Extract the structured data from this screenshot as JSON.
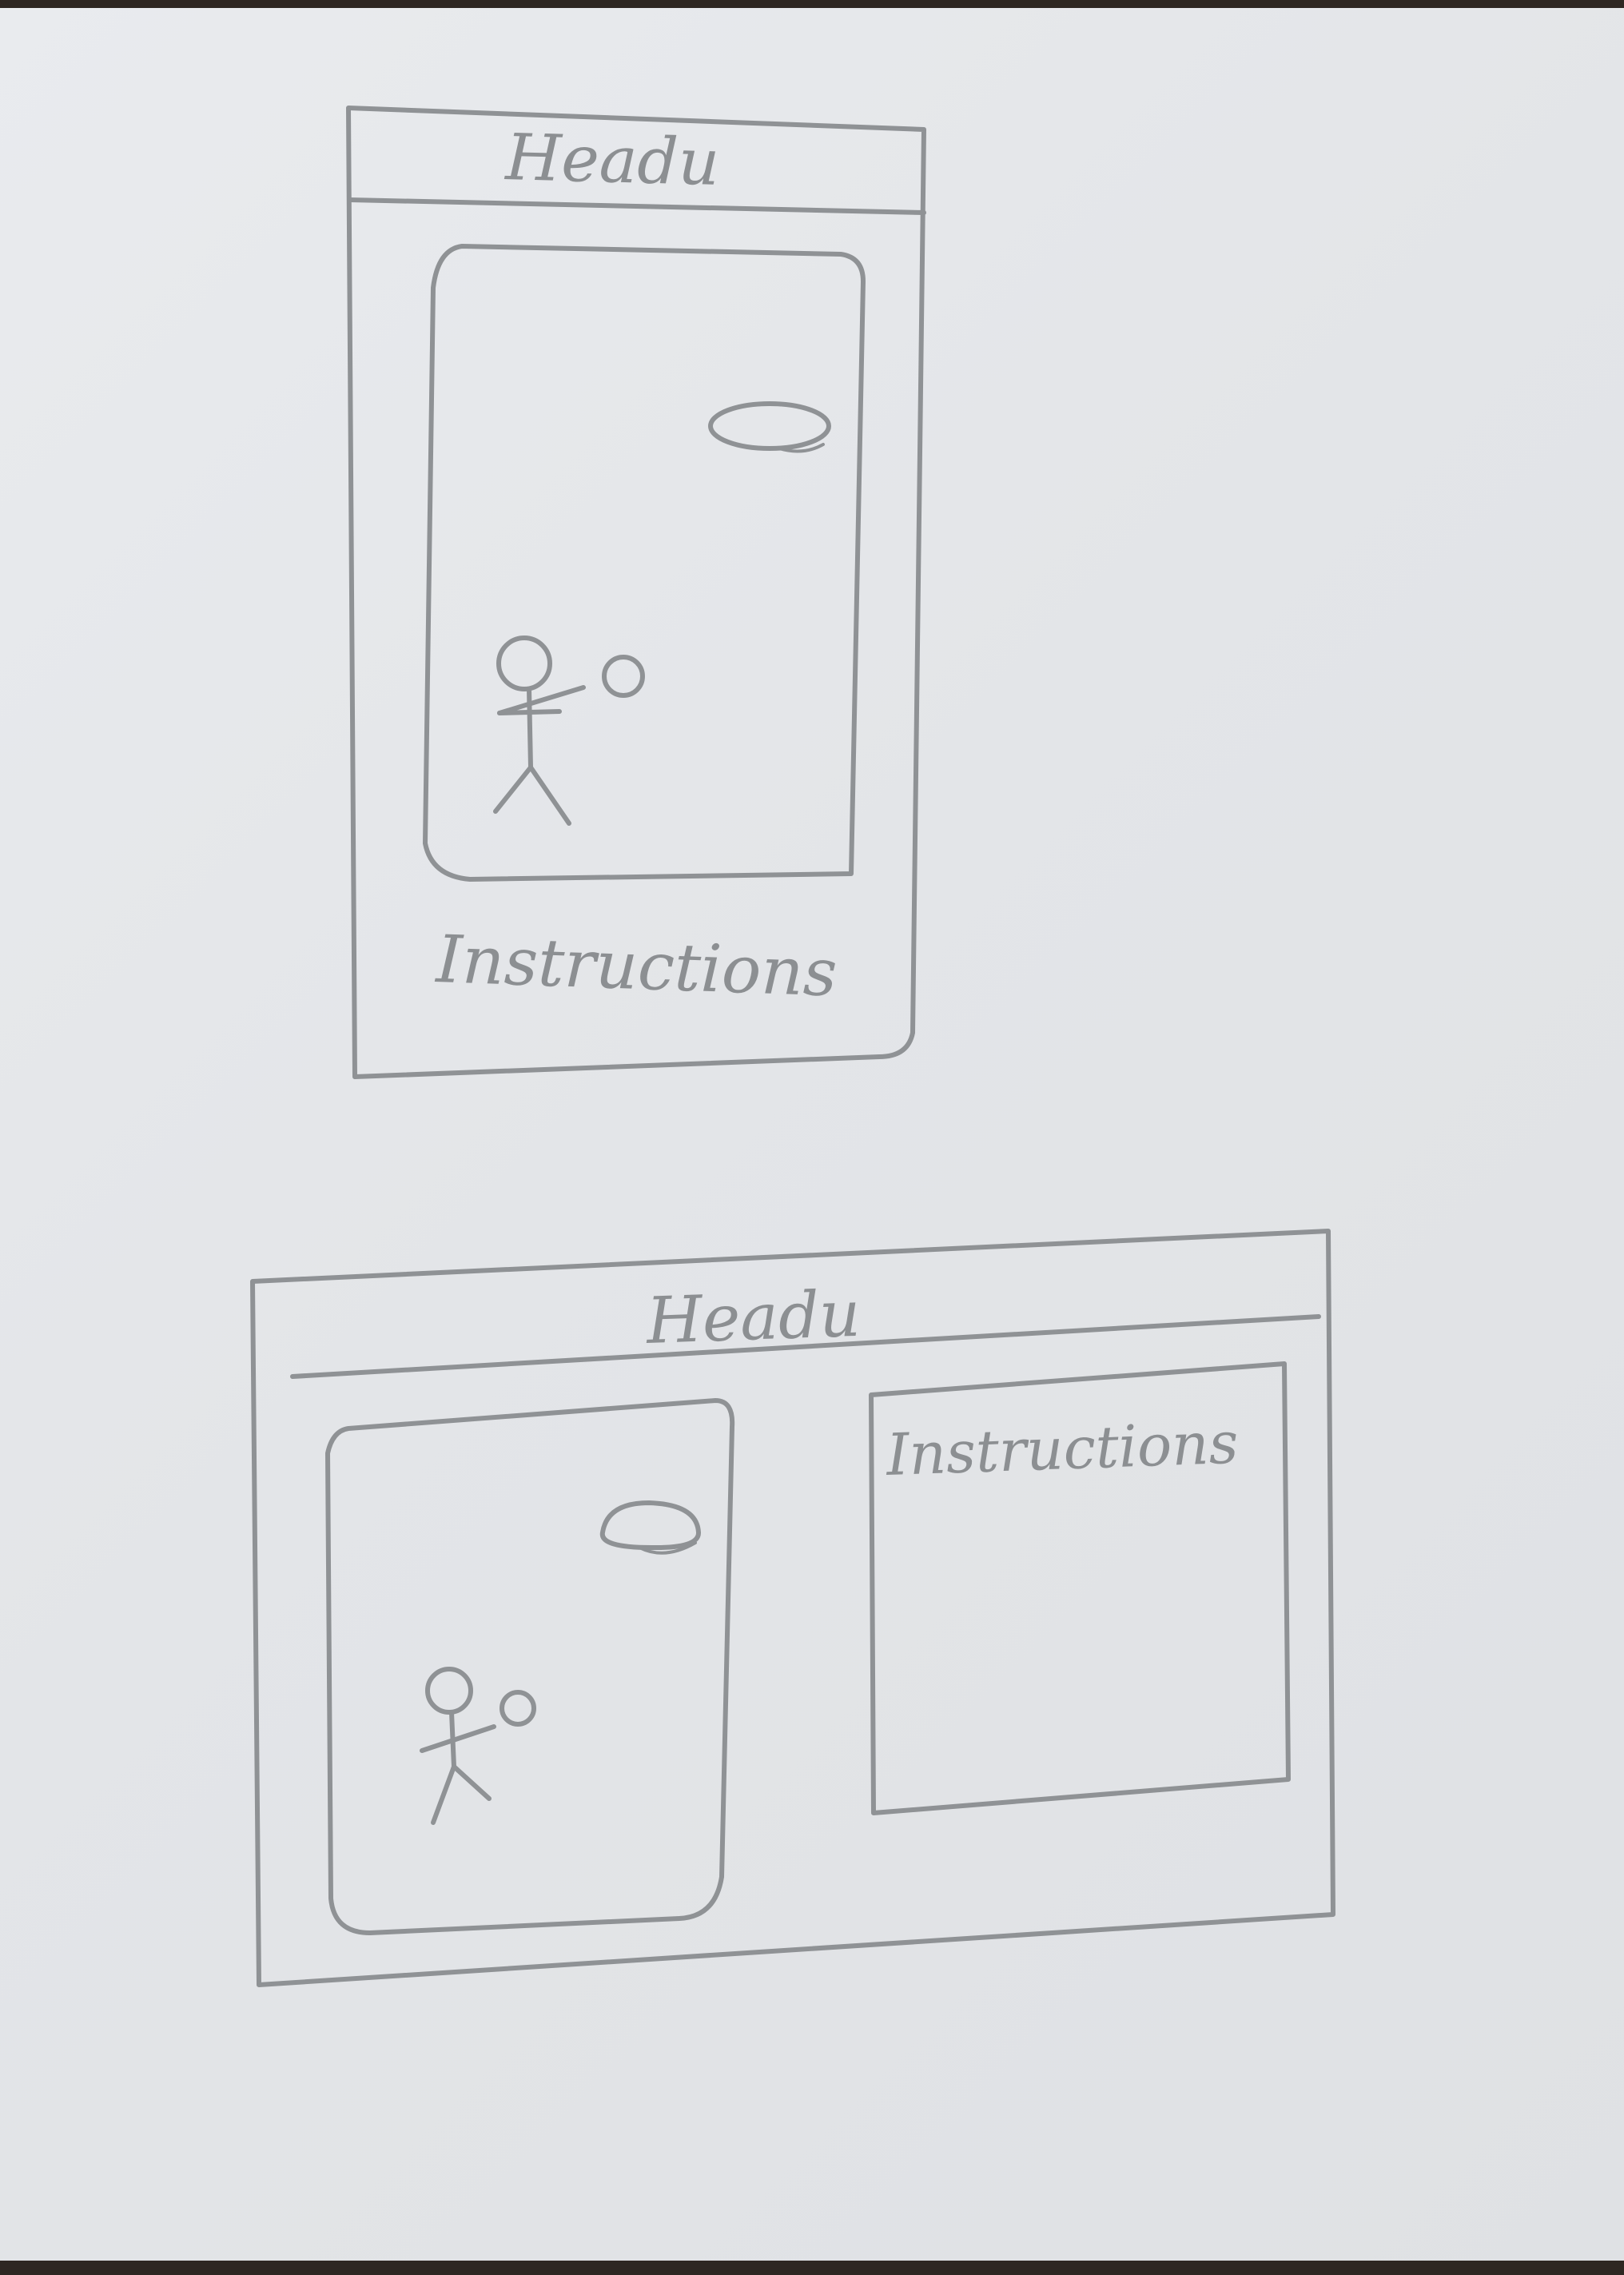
{
  "sketches": [
    {
      "id": "portrait",
      "header": {
        "label": "Headu"
      },
      "instructions": {
        "label": "Instructions"
      }
    },
    {
      "id": "landscape",
      "header": {
        "label": "Headu"
      },
      "instructions": {
        "label": "Instructions"
      }
    }
  ],
  "colors": {
    "paper": "#e4e6e9",
    "pencil": "#8c8f92",
    "table": "#2e2722"
  }
}
